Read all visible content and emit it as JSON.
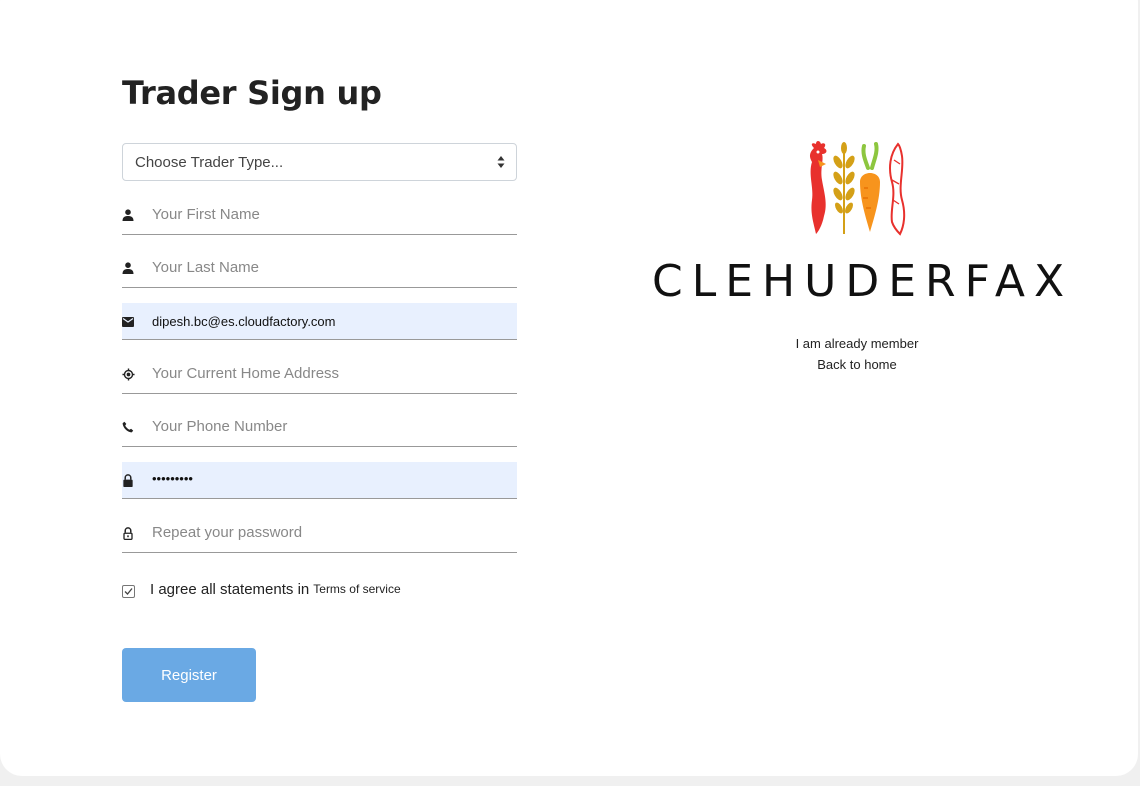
{
  "form": {
    "title": "Trader Sign up",
    "trader_type": {
      "selected": "Choose Trader Type..."
    },
    "first_name": {
      "placeholder": "Your First Name",
      "icon": "person-icon"
    },
    "last_name": {
      "placeholder": "Your Last Name",
      "icon": "person-icon"
    },
    "email": {
      "value": "dipesh.bc@es.cloudfactory.com",
      "icon": "mail-icon"
    },
    "address": {
      "placeholder": "Your Current Home Address",
      "icon": "location-icon"
    },
    "phone": {
      "placeholder": "Your Phone Number",
      "icon": "phone-icon"
    },
    "password": {
      "value": "•••••••••",
      "icon": "lock-icon"
    },
    "repeat_password": {
      "placeholder": "Repeat your password",
      "icon": "lock-outline-icon"
    },
    "agree_label": "I agree all statements in",
    "terms_link": "Terms of service",
    "agree_checked": true,
    "register_label": "Register"
  },
  "brand": {
    "name": "CLEHUDERFAX",
    "logo_colors": [
      "#e8312d",
      "#d4a017",
      "#f7941d",
      "#8dc63f"
    ]
  },
  "links": {
    "member": "I am already member",
    "home": "Back to home"
  },
  "colors": {
    "accent": "#6aa9e4",
    "autofill": "#e8f0fe"
  }
}
